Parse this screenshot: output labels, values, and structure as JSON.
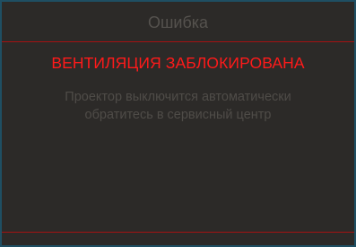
{
  "dialog": {
    "title": "Ошибка",
    "warning": "ВЕНТИЛЯЦИЯ ЗАБЛОКИРОВАНА",
    "message_lines": [
      "Проектор выключится автоматически",
      "обратитесь в сервисный центр"
    ]
  },
  "colors": {
    "background": "#2c2a28",
    "border": "#1f4f63",
    "divider": "#a31212",
    "warning_text": "#ff1a1a",
    "dim_text": "#55524e"
  }
}
